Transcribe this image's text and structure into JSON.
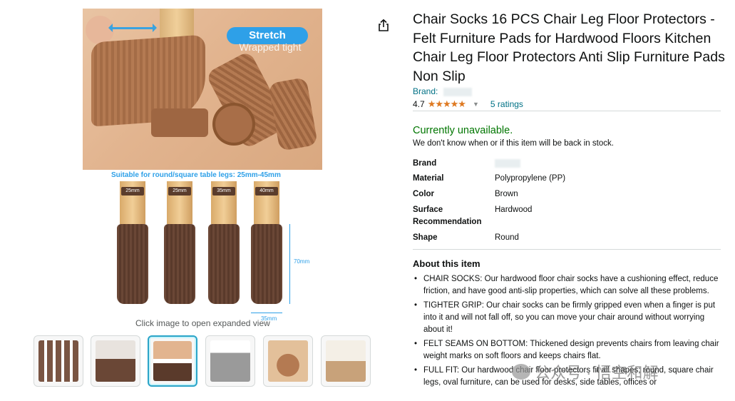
{
  "main_image": {
    "stretch_label": "Stretch",
    "stretch_sub": "Wrapped tight",
    "caption": "Suitable for round/square table legs: 25mm-45mm",
    "leg_tags": [
      "25mm",
      "25mm",
      "35mm",
      "40mm"
    ],
    "dim_height": "70mm",
    "dim_width": "35mm",
    "click_caption": "Click image to open expanded view"
  },
  "thumbnails": [
    {
      "name": "thumb-1",
      "selected": false
    },
    {
      "name": "thumb-2",
      "selected": false
    },
    {
      "name": "thumb-3",
      "selected": true
    },
    {
      "name": "thumb-4",
      "selected": false
    },
    {
      "name": "thumb-5",
      "selected": false
    },
    {
      "name": "thumb-6",
      "selected": false
    }
  ],
  "product": {
    "title": "Chair Socks 16 PCS Chair Leg Floor Protectors - Felt Furniture Pads for Hardwood Floors Kitchen Chair Leg Floor Protectors Anti Slip Furniture Pads Non Slip",
    "brand_prefix": "Brand: ",
    "rating_value": "4.7",
    "stars": "★★★★★",
    "ratings_count": "5 ratings",
    "availability": "Currently unavailable.",
    "availability_sub": "We don't know when or if this item will be back in stock."
  },
  "specs": [
    {
      "key": "Brand",
      "value": ""
    },
    {
      "key": "Material",
      "value": "Polypropylene (PP)"
    },
    {
      "key": "Color",
      "value": "Brown"
    },
    {
      "key": "Surface Recommendation",
      "value": "Hardwood"
    },
    {
      "key": "Shape",
      "value": "Round"
    }
  ],
  "about": {
    "title": "About this item",
    "bullets": [
      "CHAIR SOCKS: Our hardwood floor chair socks have a cushioning effect, reduce friction, and have good anti-slip properties, which can solve all these problems.",
      "TIGHTER GRIP: Our chair socks can be firmly gripped even when a finger is put into it and will not fall off, so you can move your chair around without worrying about it!",
      "FELT SEAMS ON BOTTOM: Thickened design prevents chairs from leaving chair weight marks on soft floors and keeps chairs flat.",
      "FULL FIT: Our hardwood chair floor protectors fit all shapes; round, square chair legs, oval furniture, can be used for desks, side tables, offices or"
    ]
  },
  "watermark": {
    "text": "公众号 · 悟空和解"
  },
  "colors": {
    "link": "#007185",
    "available_green": "#007600",
    "star": "#de7921",
    "accent_blue": "#2ea0e8"
  },
  "icons": {
    "share": "share-icon",
    "chevron": "chevron-down-icon"
  }
}
